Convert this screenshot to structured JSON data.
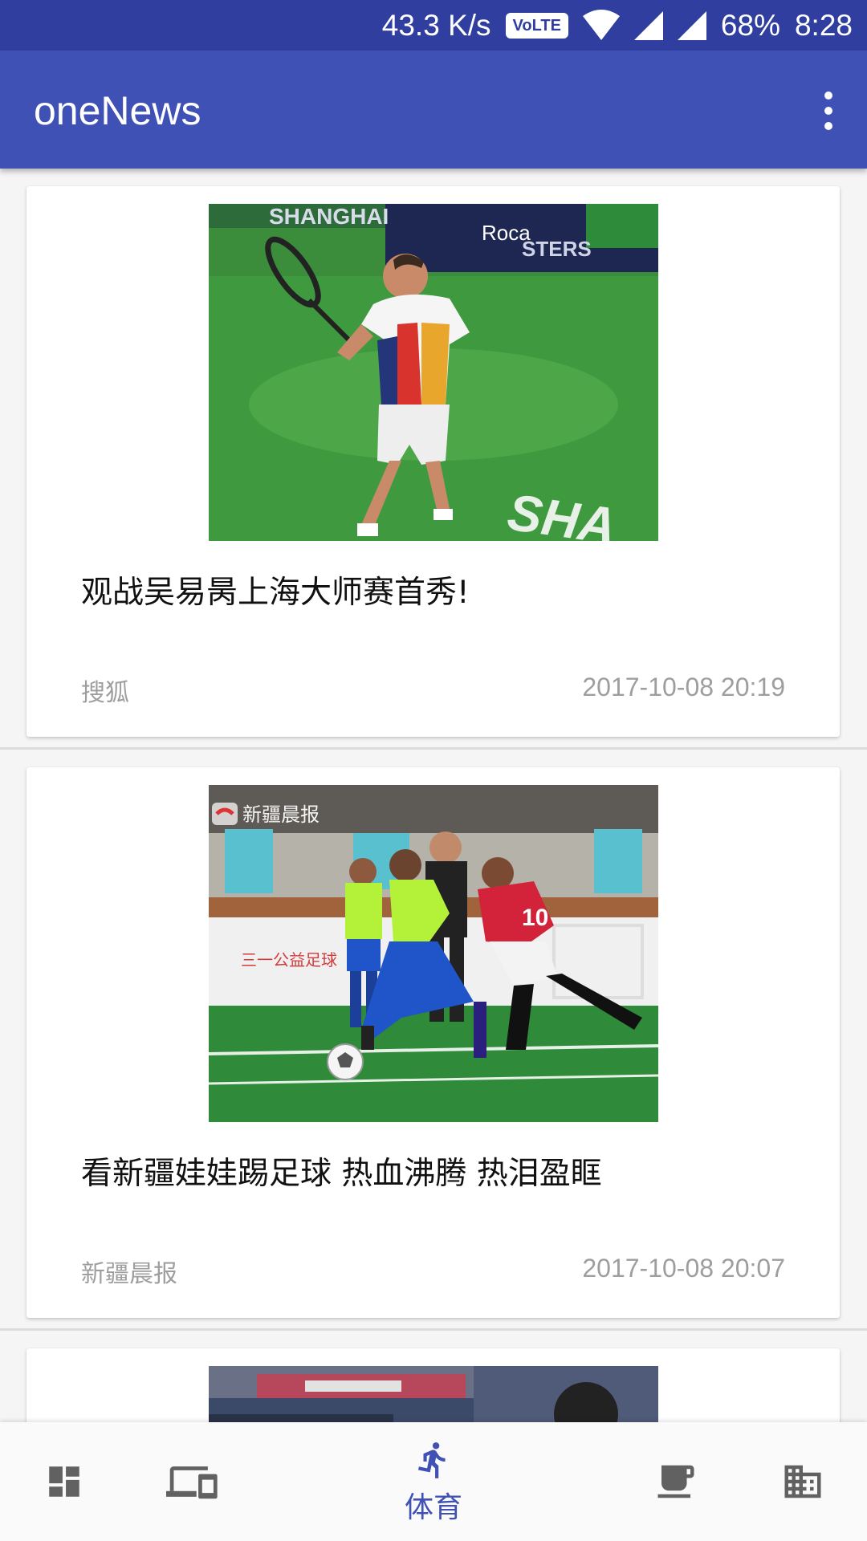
{
  "status_bar": {
    "net_speed": "43.3 K/s",
    "volte": "VoLTE",
    "battery": "68%",
    "time": "8:28"
  },
  "app_bar": {
    "title": "oneNews",
    "overflow_icon": "more-vert-icon"
  },
  "feed": {
    "items": [
      {
        "title": "观战吴易昺上海大师赛首秀!",
        "source": "搜狐",
        "time": "2017-10-08 20:19",
        "image": "tennis-player-photo",
        "image_texts": [
          "SHANGHAI",
          "Roca",
          "STERS",
          "SHA"
        ]
      },
      {
        "title": "看新疆娃娃踢足球 热血沸腾 热泪盈眶",
        "source": "新疆晨报",
        "time": "2017-10-08 20:07",
        "image": "kids-football-photo",
        "image_texts": [
          "新疆晨报",
          "三一公益足球"
        ]
      },
      {
        "image": "stadium-photo"
      }
    ]
  },
  "bottom_nav": {
    "items": [
      {
        "icon": "dashboard-icon"
      },
      {
        "icon": "devices-icon"
      },
      {
        "icon": "run-icon",
        "label": "体育",
        "active": true
      },
      {
        "icon": "coffee-icon"
      },
      {
        "icon": "business-icon"
      }
    ],
    "active_color": "#3f51b5",
    "inactive_color": "#616161"
  },
  "colors": {
    "primary": "#3f51b5",
    "primary_dark": "#303f9f"
  }
}
